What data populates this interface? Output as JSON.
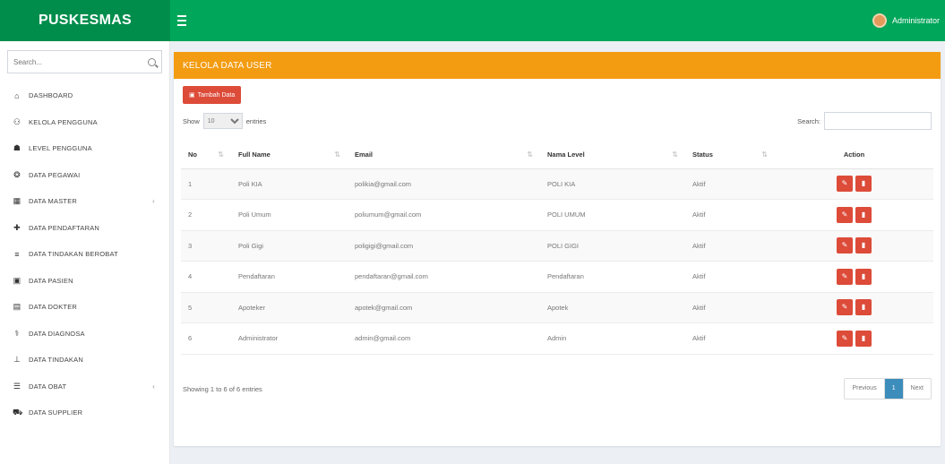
{
  "header": {
    "logo": "PUSKESMAS",
    "user": "Administrator"
  },
  "sidebar": {
    "search_placeholder": "Search...",
    "items": [
      {
        "label": "DASHBOARD",
        "icon": "home-icon",
        "glyph": "⌂"
      },
      {
        "label": "KELOLA PENGGUNA",
        "icon": "user-icon",
        "glyph": "⚇"
      },
      {
        "label": "LEVEL PENGGUNA",
        "icon": "users-icon",
        "glyph": "☗"
      },
      {
        "label": "DATA PEGAWAI",
        "icon": "employee-icon",
        "glyph": "❂"
      },
      {
        "label": "DATA MASTER",
        "icon": "grid-icon",
        "glyph": "▦",
        "chevron": "‹"
      },
      {
        "label": "DATA PENDAFTARAN",
        "icon": "stethoscope-icon",
        "glyph": "✚"
      },
      {
        "label": "DATA TINDAKAN BEROBAT",
        "icon": "list-icon",
        "glyph": "≡"
      },
      {
        "label": "DATA PASIEN",
        "icon": "patient-icon",
        "glyph": "▣"
      },
      {
        "label": "DATA DOKTER",
        "icon": "doctor-icon",
        "glyph": "▤"
      },
      {
        "label": "DATA DIAGNOSA",
        "icon": "diagnosis-icon",
        "glyph": "⚕"
      },
      {
        "label": "DATA TINDAKAN",
        "icon": "action-icon",
        "glyph": "⊥"
      },
      {
        "label": "DATA OBAT",
        "icon": "medicine-icon",
        "glyph": "☰",
        "chevron": "‹"
      },
      {
        "label": "DATA SUPPLIER",
        "icon": "truck-icon",
        "glyph": "⛟"
      }
    ]
  },
  "main": {
    "title": "KELOLA DATA USER",
    "add_button": "Tambah Data",
    "show_label": "Show",
    "entries_value": "10",
    "entries_label": "entries",
    "search_label": "Search:",
    "columns": [
      "No",
      "Full Name",
      "Email",
      "Nama Level",
      "Status",
      "Action"
    ],
    "rows": [
      {
        "no": "1",
        "name": "Poli KIA",
        "email": "polikia@gmail.com",
        "level": "POLI KIA",
        "status": "Aktif"
      },
      {
        "no": "2",
        "name": "Poli Umum",
        "email": "poliumum@gmail.com",
        "level": "POLI UMUM",
        "status": "Aktif"
      },
      {
        "no": "3",
        "name": "Poli Gigi",
        "email": "poligigi@gmail.com",
        "level": "POLI GIGI",
        "status": "Aktif"
      },
      {
        "no": "4",
        "name": "Pendaftaran",
        "email": "pendaftaran@gmail.com",
        "level": "Pendaftaran",
        "status": "Aktif"
      },
      {
        "no": "5",
        "name": "Apoteker",
        "email": "apotek@gmail.com",
        "level": "Apotek",
        "status": "Aktif"
      },
      {
        "no": "6",
        "name": "Administrator",
        "email": "admin@gmail.com",
        "level": "Admin",
        "status": "Aktif"
      }
    ],
    "info": "Showing 1 to 6 of 6 entries",
    "pager": {
      "prev": "Previous",
      "page": "1",
      "next": "Next"
    }
  },
  "colors": {
    "header": "#00a65a",
    "logo_bg": "#008d4c",
    "box_header": "#f39c12",
    "danger": "#dd4b39",
    "primary": "#3c8dbc"
  }
}
